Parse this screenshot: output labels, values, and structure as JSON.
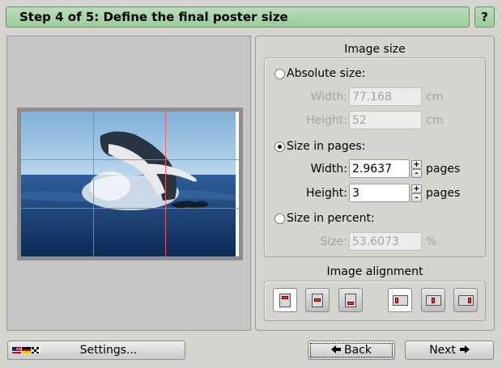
{
  "header": {
    "title": "Step 4 of 5: Define the final poster size",
    "help_label": "?"
  },
  "image_size": {
    "title": "Image size",
    "absolute": {
      "label": "Absolute size:",
      "width_label": "Width:",
      "width_value": "77.168",
      "width_unit": "cm",
      "height_label": "Height:",
      "height_value": "52",
      "height_unit": "cm"
    },
    "pages": {
      "label": "Size in pages:",
      "width_label": "Width:",
      "width_value": "2.9637",
      "width_unit": "pages",
      "height_label": "Height:",
      "height_value": "3",
      "height_unit": "pages",
      "plus": "+",
      "minus": "-"
    },
    "percent": {
      "label": "Size in percent:",
      "size_label": "Size:",
      "size_value": "53.6073",
      "size_unit": "%"
    },
    "selected": "pages"
  },
  "alignment": {
    "title": "Image alignment",
    "buttons": [
      "align-top",
      "align-middle-vertical",
      "align-bottom",
      "align-left",
      "align-center-horizontal",
      "align-right"
    ],
    "selected": [
      "align-top",
      "align-left"
    ]
  },
  "footer": {
    "settings_label": "Settings...",
    "back_label": "Back",
    "next_label": "Next"
  },
  "colors": {
    "header_green": "#9ccd9c",
    "grid_line": "#ff5a5a"
  }
}
